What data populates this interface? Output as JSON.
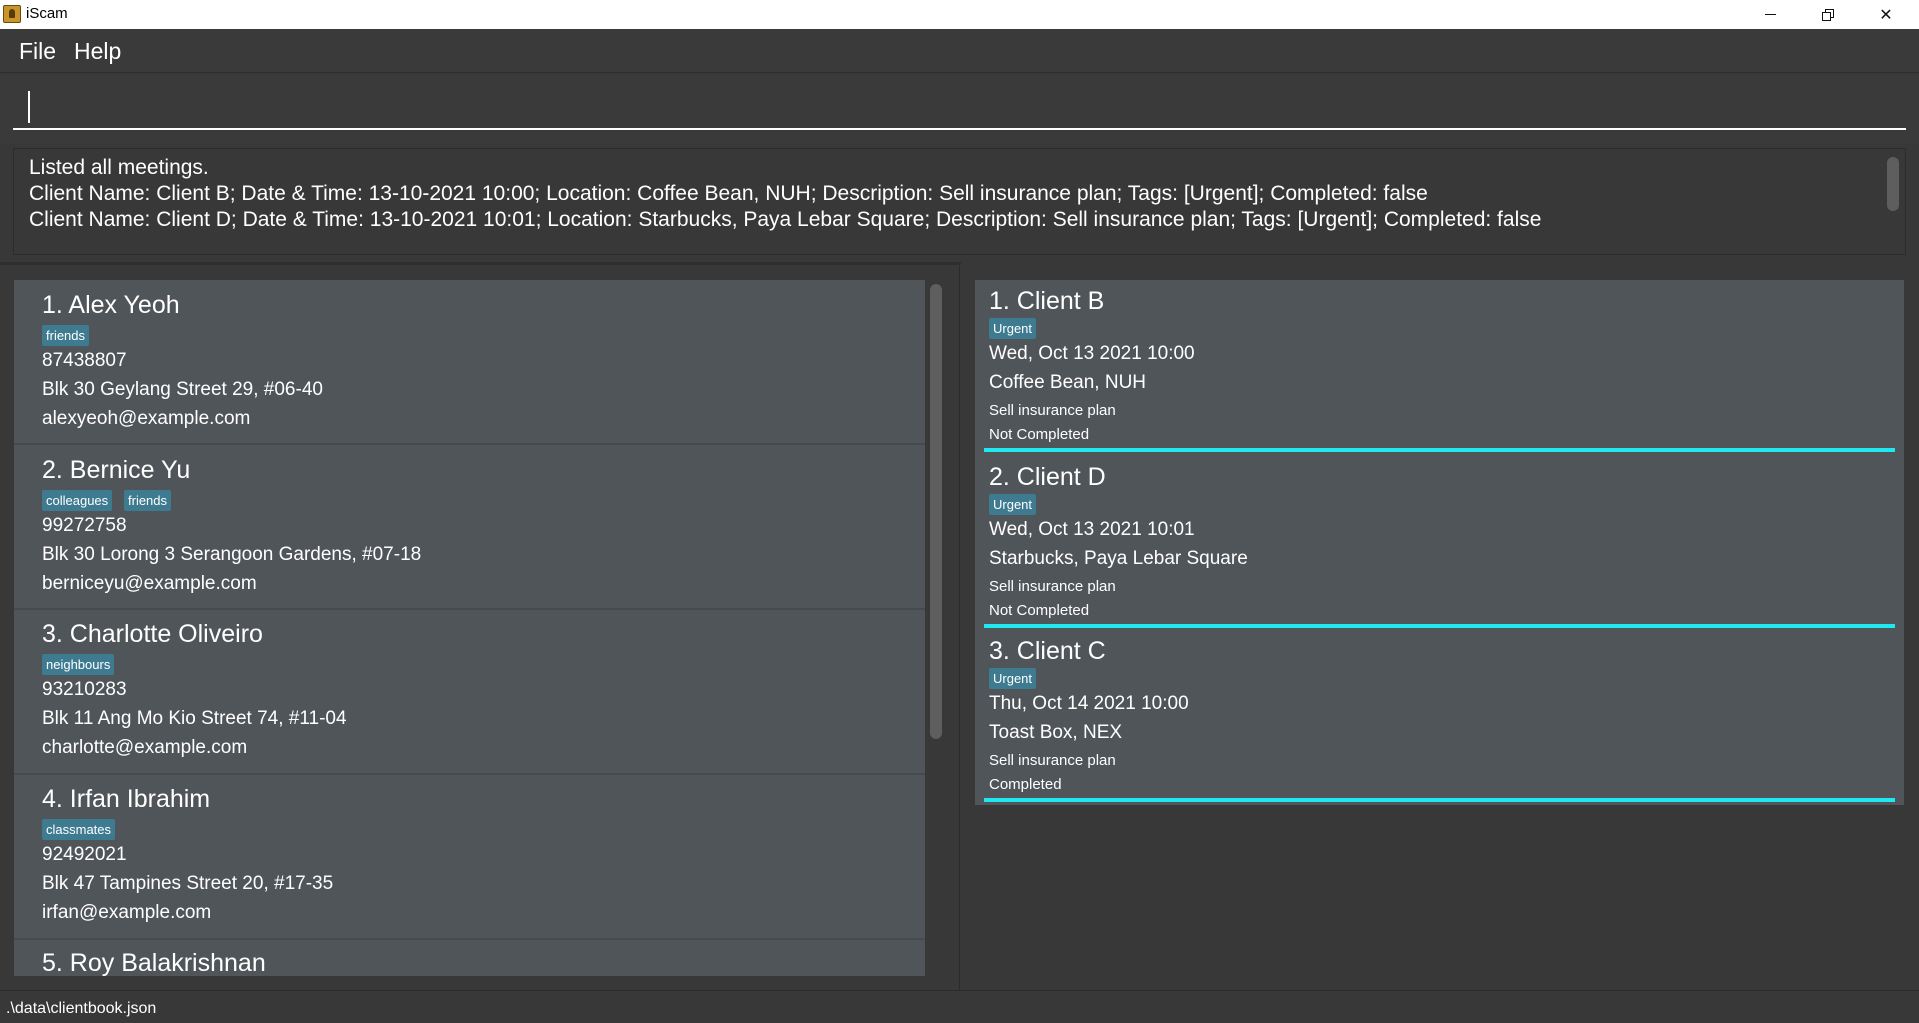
{
  "window": {
    "title": "iScam",
    "minimize_icon": "minimize-icon",
    "restore_icon": "restore-icon",
    "close_glyph": "✕"
  },
  "menu": {
    "file": "File",
    "help": "Help"
  },
  "command": {
    "value": "",
    "placeholder": ""
  },
  "result": {
    "lines": [
      "Listed all meetings.",
      "Client Name: Client B; Date & Time: 13-10-2021 10:00; Location: Coffee Bean, NUH; Description: Sell insurance plan; Tags: [Urgent]; Completed: false",
      "Client Name: Client  D; Date & Time: 13-10-2021 10:01; Location: Starbucks, Paya Lebar Square; Description: Sell insurance plan; Tags: [Urgent]; Completed: false"
    ]
  },
  "persons": [
    {
      "title": "1.  Alex Yeoh",
      "tags": [
        "friends"
      ],
      "phone": "87438807",
      "address": "Blk 30 Geylang Street 29, #06-40",
      "email": "alexyeoh@example.com"
    },
    {
      "title": "2.  Bernice Yu",
      "tags": [
        "colleagues",
        "friends"
      ],
      "phone": "99272758",
      "address": "Blk 30 Lorong 3 Serangoon Gardens, #07-18",
      "email": "berniceyu@example.com"
    },
    {
      "title": "3.  Charlotte Oliveiro",
      "tags": [
        "neighbours"
      ],
      "phone": "93210283",
      "address": "Blk 11 Ang Mo Kio Street 74, #11-04",
      "email": "charlotte@example.com"
    },
    {
      "title": "4.  Irfan Ibrahim",
      "tags": [
        "classmates"
      ],
      "phone": "92492021",
      "address": "Blk 47 Tampines Street 20, #17-35",
      "email": "irfan@example.com"
    },
    {
      "title": "5.  Roy Balakrishnan",
      "tags": [],
      "phone": "",
      "address": "",
      "email": ""
    }
  ],
  "meetings": [
    {
      "title": "1.  Client B",
      "tag": "Urgent",
      "datetime": "Wed, Oct 13 2021 10:00",
      "location": "Coffee Bean, NUH",
      "description": "Sell insurance plan",
      "status": "Not Completed"
    },
    {
      "title": "2.  Client  D",
      "tag": "Urgent",
      "datetime": "Wed, Oct 13 2021 10:01",
      "location": "Starbucks, Paya Lebar Square",
      "description": "Sell insurance plan",
      "status": "Not Completed"
    },
    {
      "title": "3.  Client C",
      "tag": "Urgent",
      "datetime": "Thu, Oct 14 2021 10:00",
      "location": "Toast Box, NEX",
      "description": "Sell insurance plan",
      "status": "Completed"
    }
  ],
  "status_bar": {
    "path": ".\\data\\clientbook.json"
  },
  "colors": {
    "background": "#383838",
    "card": "#50555a",
    "tag": "#3e7b91",
    "meeting_accent": "#21e8f0"
  }
}
